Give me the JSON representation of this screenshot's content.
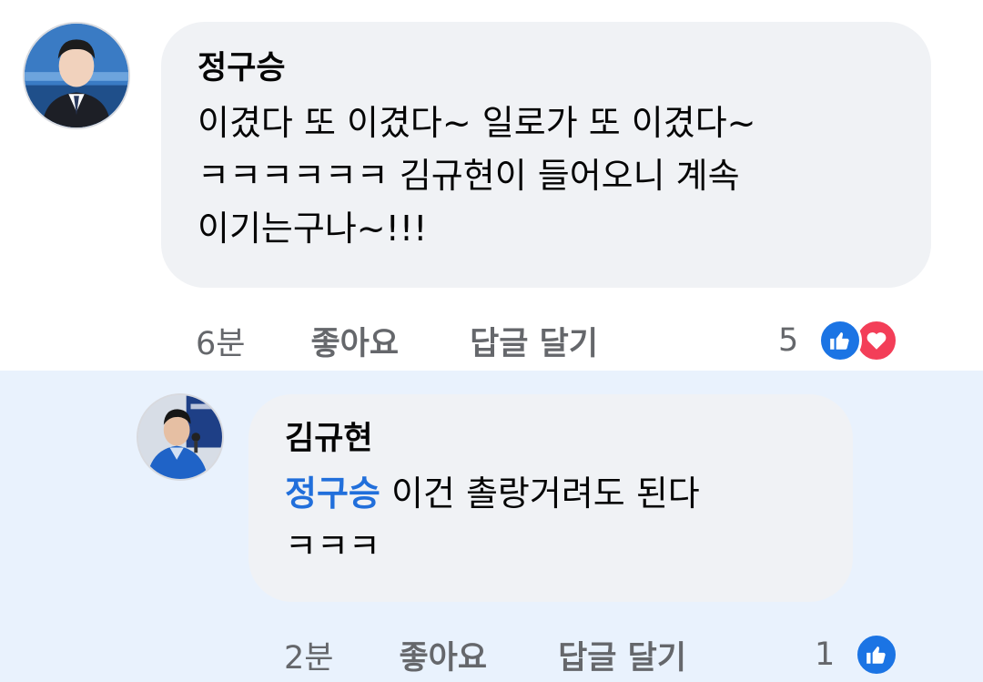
{
  "comments": [
    {
      "author": "정구승",
      "text_lines": [
        "이겼다 또 이겼다~ 일로가 또 이겼다~",
        "ㅋㅋㅋㅋㅋㅋ 김규현이 들어오니 계속",
        "이기는구나~!!!"
      ],
      "time": "6분",
      "like_label": "좋아요",
      "reply_label": "답글 달기",
      "reaction_count": "5",
      "reactions": [
        "like-icon",
        "love-icon"
      ]
    },
    {
      "author": "김규현",
      "mention": "정구승",
      "text_line_1": " 이건 촐랑거려도 된다",
      "text_line_2": "ㅋㅋㅋ",
      "time": "2분",
      "like_label": "좋아요",
      "reply_label": "답글 달기",
      "reaction_count": "1",
      "reactions": [
        "like-icon"
      ]
    }
  ],
  "colors": {
    "bubble": "#f0f2f5",
    "reply_background": "#e9f2fd",
    "mention": "#216fdb",
    "secondary_text": "#65676b",
    "like": "#1b74e4",
    "love": "#f33e58"
  }
}
